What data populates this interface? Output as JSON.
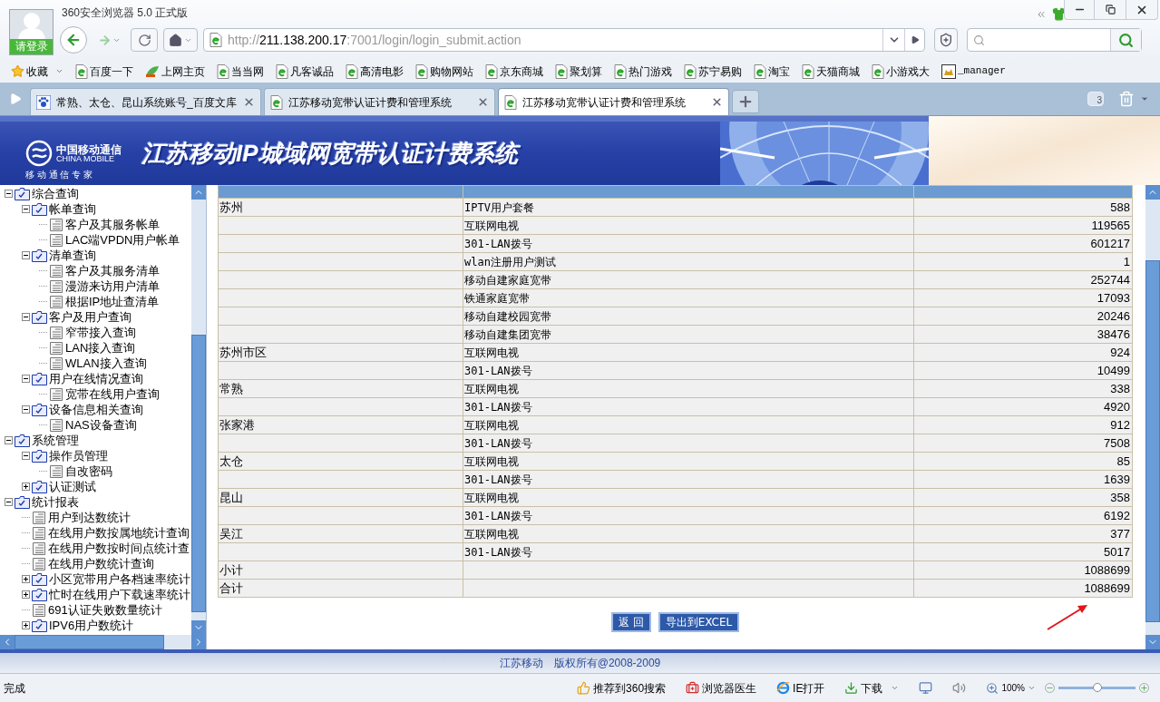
{
  "window": {
    "title": "360安全浏览器 5.0 正式版",
    "login_label": "请登录"
  },
  "address_bar": {
    "scheme": "http://",
    "host": "211.138.200.17",
    "path": ":7001/login/login_submit.action"
  },
  "bookmarks": [
    {
      "label": "收藏",
      "kind": "favorites"
    },
    {
      "label": "百度一下",
      "kind": "page"
    },
    {
      "label": "上网主页",
      "kind": "hao"
    },
    {
      "label": "当当网",
      "kind": "page"
    },
    {
      "label": "凡客诚品",
      "kind": "page"
    },
    {
      "label": "高清电影",
      "kind": "page"
    },
    {
      "label": "购物网站",
      "kind": "page"
    },
    {
      "label": "京东商城",
      "kind": "page"
    },
    {
      "label": "聚划算",
      "kind": "page"
    },
    {
      "label": "热门游戏",
      "kind": "page"
    },
    {
      "label": "苏宁易购",
      "kind": "page"
    },
    {
      "label": "淘宝",
      "kind": "page"
    },
    {
      "label": "天猫商城",
      "kind": "page"
    },
    {
      "label": "小游戏大",
      "kind": "page"
    },
    {
      "label": "_manager",
      "kind": "tomcat"
    }
  ],
  "tabs": [
    {
      "label": "常熟、太仓、昆山系统账号_百度文库",
      "kind": "paw",
      "selected": false
    },
    {
      "label": "江苏移动宽带认证计费和管理系统",
      "kind": "page",
      "selected": false
    },
    {
      "label": "江苏移动宽带认证计费和管理系统",
      "kind": "page",
      "selected": true
    }
  ],
  "tab_count": "3",
  "banner": {
    "logo_cn": "中国移动通信",
    "logo_en": "CHINA MOBILE",
    "slogan": "移 动 通 信 专 家",
    "title": "江苏移动IP城域网宽带认证计费系统"
  },
  "tree": [
    {
      "label": "综合查询",
      "kind": "folder",
      "expanded": true,
      "children": [
        {
          "label": "帐单查询",
          "kind": "folder",
          "expanded": true,
          "children": [
            {
              "label": "客户及其服务帐单",
              "kind": "leaf"
            },
            {
              "label": "LAC端VPDN用户帐单",
              "kind": "leaf"
            }
          ]
        },
        {
          "label": "清单查询",
          "kind": "folder",
          "expanded": true,
          "children": [
            {
              "label": "客户及其服务清单",
              "kind": "leaf"
            },
            {
              "label": "漫游来访用户清单",
              "kind": "leaf"
            },
            {
              "label": "根据IP地址查清单",
              "kind": "leaf"
            }
          ]
        },
        {
          "label": "客户及用户查询",
          "kind": "folder",
          "expanded": true,
          "children": [
            {
              "label": "窄带接入查询",
              "kind": "leaf"
            },
            {
              "label": "LAN接入查询",
              "kind": "leaf"
            },
            {
              "label": "WLAN接入查询",
              "kind": "leaf"
            }
          ]
        },
        {
          "label": "用户在线情况查询",
          "kind": "folder",
          "expanded": true,
          "children": [
            {
              "label": "宽带在线用户查询",
              "kind": "leaf"
            }
          ]
        },
        {
          "label": "设备信息相关查询",
          "kind": "folder",
          "expanded": true,
          "children": [
            {
              "label": "NAS设备查询",
              "kind": "leaf"
            }
          ]
        }
      ]
    },
    {
      "label": "系统管理",
      "kind": "folder",
      "expanded": true,
      "children": [
        {
          "label": "操作员管理",
          "kind": "folder",
          "expanded": true,
          "children": [
            {
              "label": "自改密码",
              "kind": "leaf"
            }
          ]
        },
        {
          "label": "认证测试",
          "kind": "folder",
          "expanded": false
        }
      ]
    },
    {
      "label": "统计报表",
      "kind": "folder",
      "expanded": true,
      "children": [
        {
          "label": "用户到达数统计",
          "kind": "leaf"
        },
        {
          "label": "在线用户数按属地统计查询",
          "kind": "leaf"
        },
        {
          "label": "在线用户数按时间点统计查",
          "kind": "leaf"
        },
        {
          "label": "在线用户数统计查询",
          "kind": "leaf"
        },
        {
          "label": "小区宽带用户各档速率统计",
          "kind": "folder",
          "expanded": false
        },
        {
          "label": "忙时在线用户下载速率统计",
          "kind": "folder",
          "expanded": false
        },
        {
          "label": "691认证失败数量统计",
          "kind": "leaf"
        },
        {
          "label": "IPV6用户数统计",
          "kind": "folder",
          "expanded": false
        }
      ]
    }
  ],
  "table": {
    "rows": [
      {
        "column_1": "苏州",
        "column_2": "IPTV用户套餐",
        "column_3": "588"
      },
      {
        "column_2": "互联网电视",
        "column_3": "119565"
      },
      {
        "column_2": "301-LAN拨号",
        "column_3": "601217"
      },
      {
        "column_2": "wlan注册用户测试",
        "column_3": "1"
      },
      {
        "column_2": "移动自建家庭宽带",
        "column_3": "252744"
      },
      {
        "column_2": "铁通家庭宽带",
        "column_3": "17093"
      },
      {
        "column_2": "移动自建校园宽带",
        "column_3": "20246"
      },
      {
        "column_2": "移动自建集团宽带",
        "column_3": "38476"
      },
      {
        "column_1": "苏州市区",
        "column_2": "互联网电视",
        "column_3": "924"
      },
      {
        "column_2": "301-LAN拨号",
        "column_3": "10499"
      },
      {
        "column_1": "常熟",
        "column_2": "互联网电视",
        "column_3": "338"
      },
      {
        "column_2": "301-LAN拨号",
        "column_3": "4920"
      },
      {
        "column_1": "张家港",
        "column_2": "互联网电视",
        "column_3": "912"
      },
      {
        "column_2": "301-LAN拨号",
        "column_3": "7508"
      },
      {
        "column_1": "太仓",
        "column_2": "互联网电视",
        "column_3": "85"
      },
      {
        "column_2": "301-LAN拨号",
        "column_3": "1639"
      },
      {
        "column_1": "昆山",
        "column_2": "互联网电视",
        "column_3": "358"
      },
      {
        "column_2": "301-LAN拨号",
        "column_3": "6192"
      },
      {
        "column_1": "吴江",
        "column_2": "互联网电视",
        "column_3": "377"
      },
      {
        "column_2": "301-LAN拨号",
        "column_3": "5017"
      },
      {
        "column_1": "小计",
        "column_3": "1088699"
      },
      {
        "column_1": "合计",
        "column_3": "1088699"
      }
    ]
  },
  "buttons": [
    "返 回",
    "导出到EXCEL"
  ],
  "footer": {
    "company": "江苏移动",
    "copyright": "版权所有@2008-2009"
  },
  "status_bar": {
    "status": "完成",
    "items": [
      {
        "label": "推荐到360搜索",
        "kind": "thumb"
      },
      {
        "label": "浏览器医生",
        "kind": "doctor"
      },
      {
        "label": "IE打开",
        "kind": "ie"
      },
      {
        "label": "下载",
        "kind": "download"
      }
    ],
    "zoom": "100%",
    "zoom_slider": {
      "level": 0.5
    }
  }
}
